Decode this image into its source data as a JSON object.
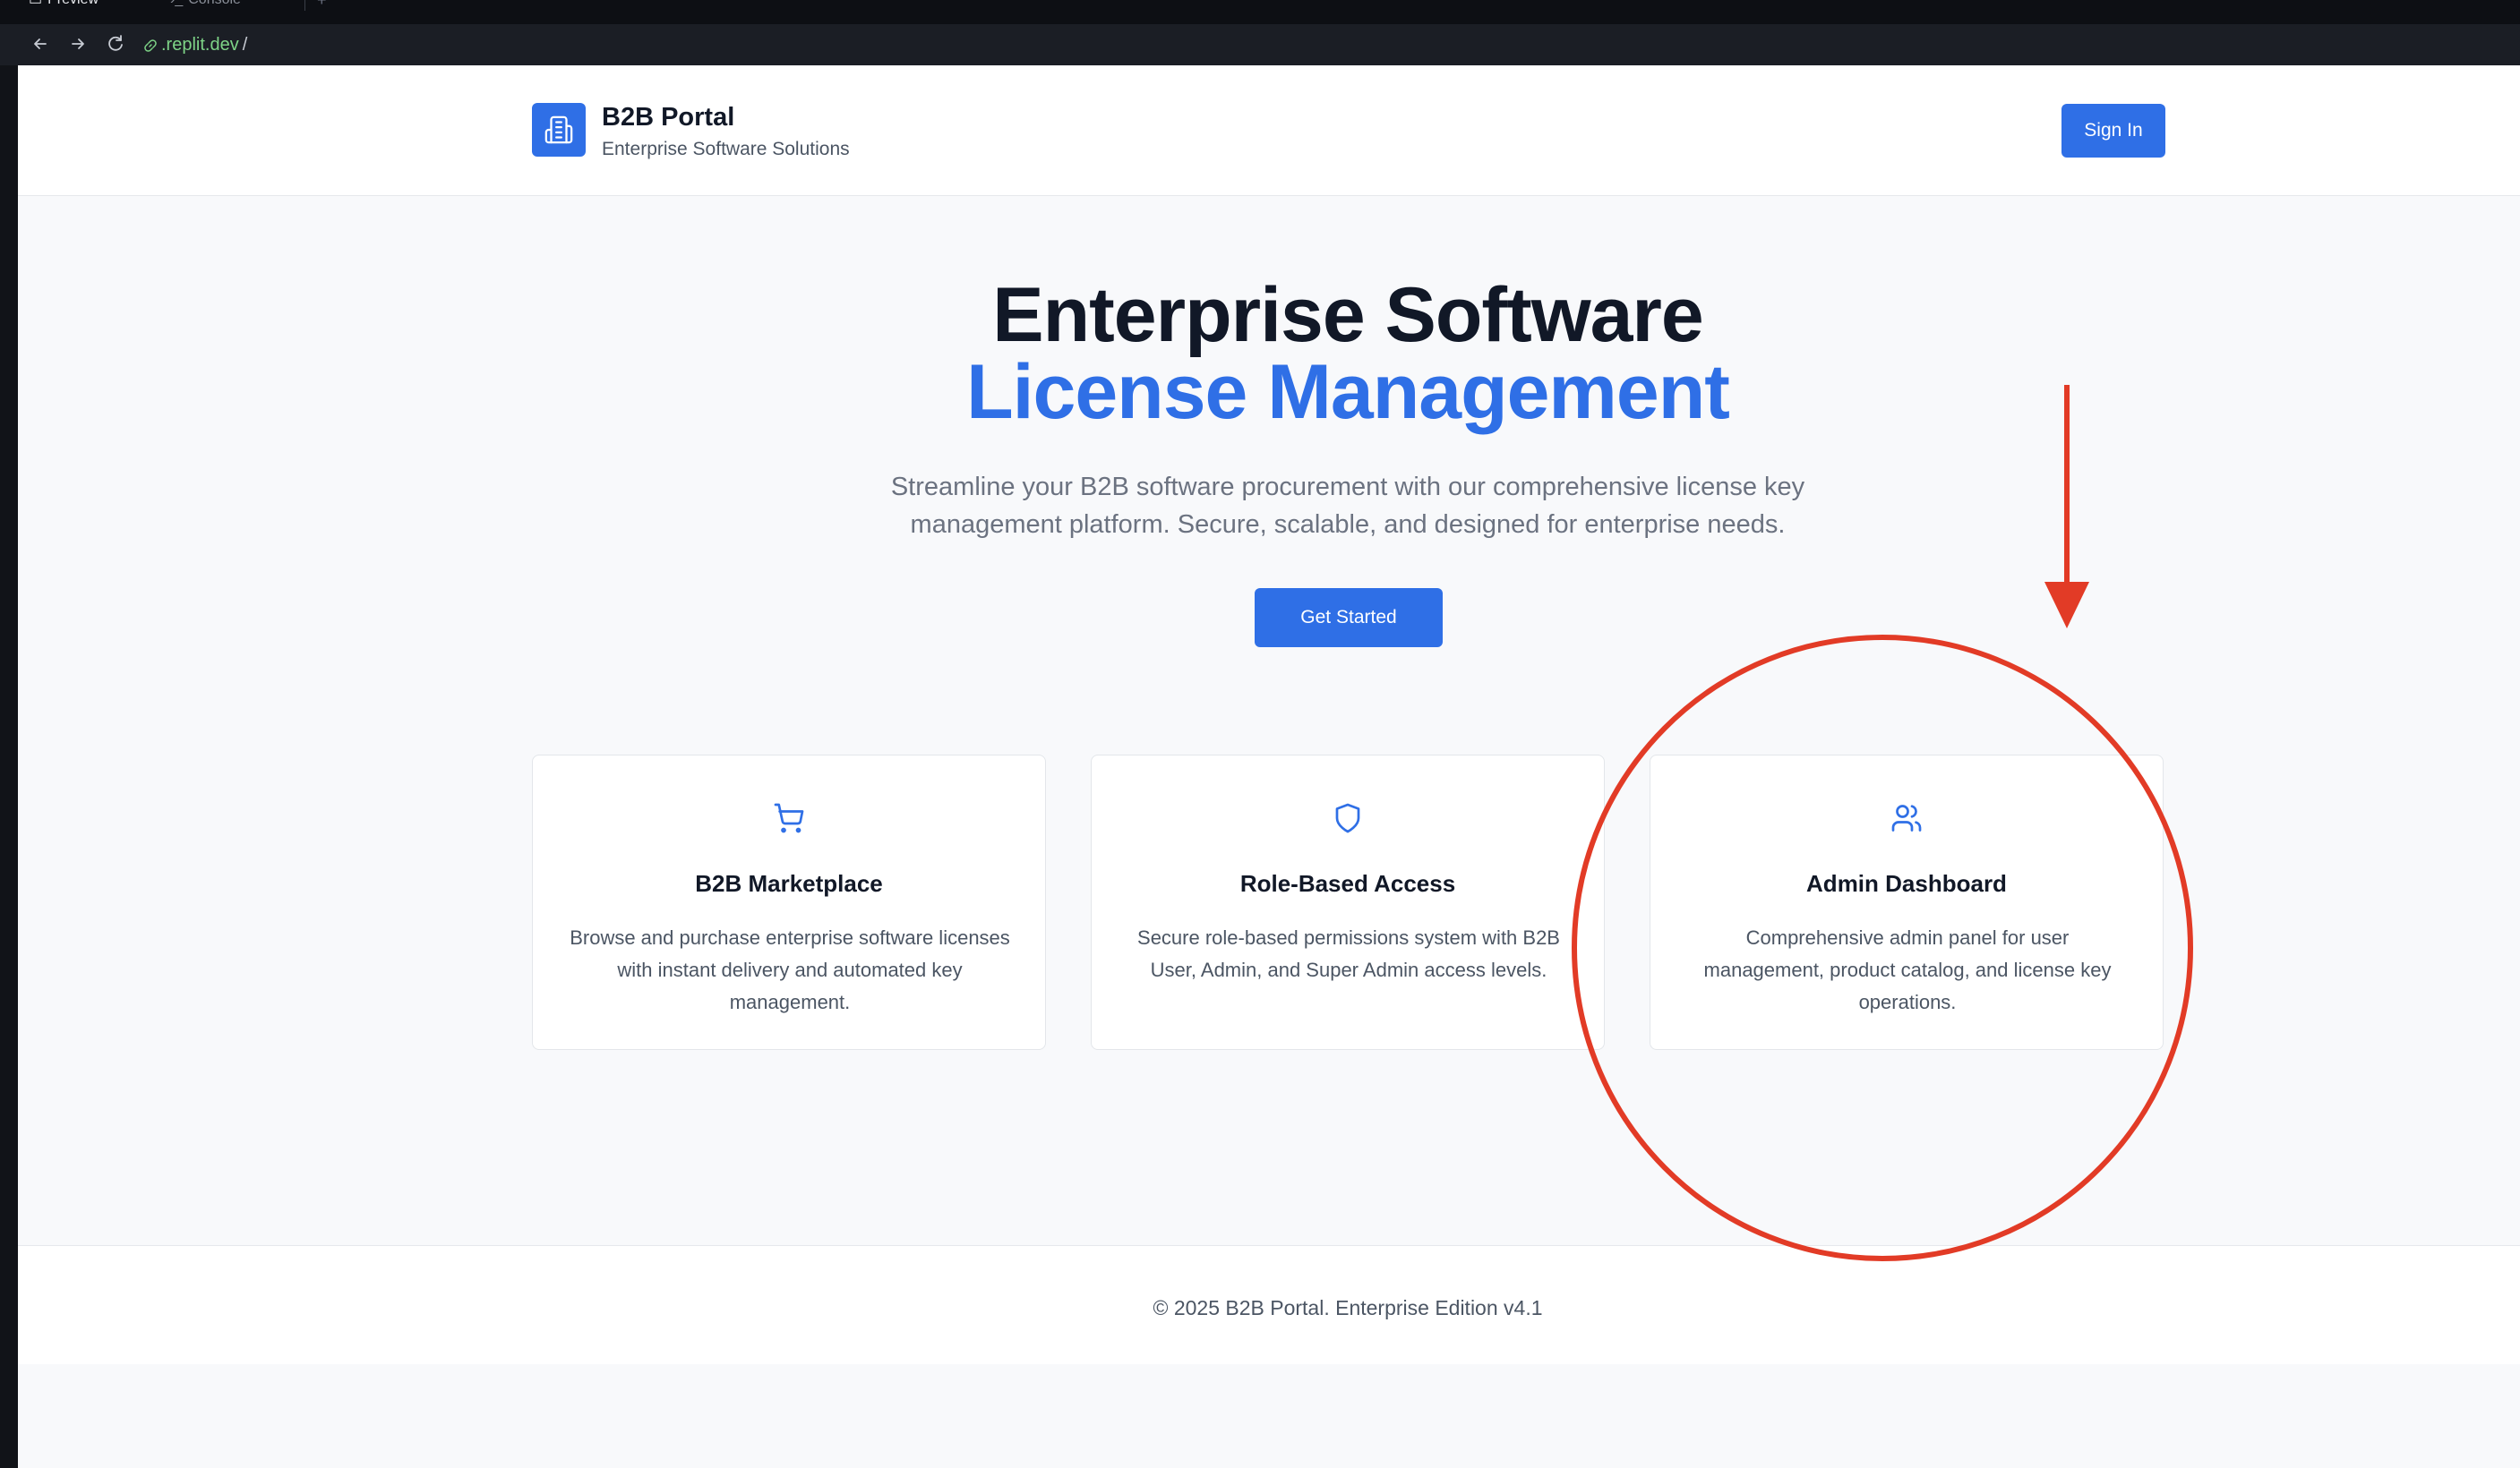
{
  "browser": {
    "tabs": [
      {
        "label": "Preview"
      },
      {
        "label": "Console"
      }
    ],
    "url_host": ".replit.dev",
    "url_path": "/"
  },
  "header": {
    "brand_name": "B2B Portal",
    "brand_tagline": "Enterprise Software Solutions",
    "signin_label": "Sign In",
    "logo_icon": "building-icon"
  },
  "hero": {
    "title_line1": "Enterprise Software",
    "title_line2": "License Management",
    "description": "Streamline your B2B software procurement with our comprehensive license key management platform. Secure, scalable, and designed for enterprise needs.",
    "cta_label": "Get Started"
  },
  "features": [
    {
      "icon": "shopping-cart-icon",
      "title": "B2B Marketplace",
      "text": "Browse and purchase enterprise software licenses with instant delivery and automated key management."
    },
    {
      "icon": "shield-icon",
      "title": "Role-Based Access",
      "text": "Secure role-based permissions system with B2B User, Admin, and Super Admin access levels."
    },
    {
      "icon": "users-icon",
      "title": "Admin Dashboard",
      "text": "Comprehensive admin panel for user management, product catalog, and license key operations."
    }
  ],
  "footer": {
    "text": "© 2025 B2B Portal. Enterprise Edition v4.1"
  },
  "colors": {
    "accent": "#2f6fe6",
    "annotation": "#e23b26",
    "text_dark": "#111827",
    "text_muted": "#6b7280"
  }
}
